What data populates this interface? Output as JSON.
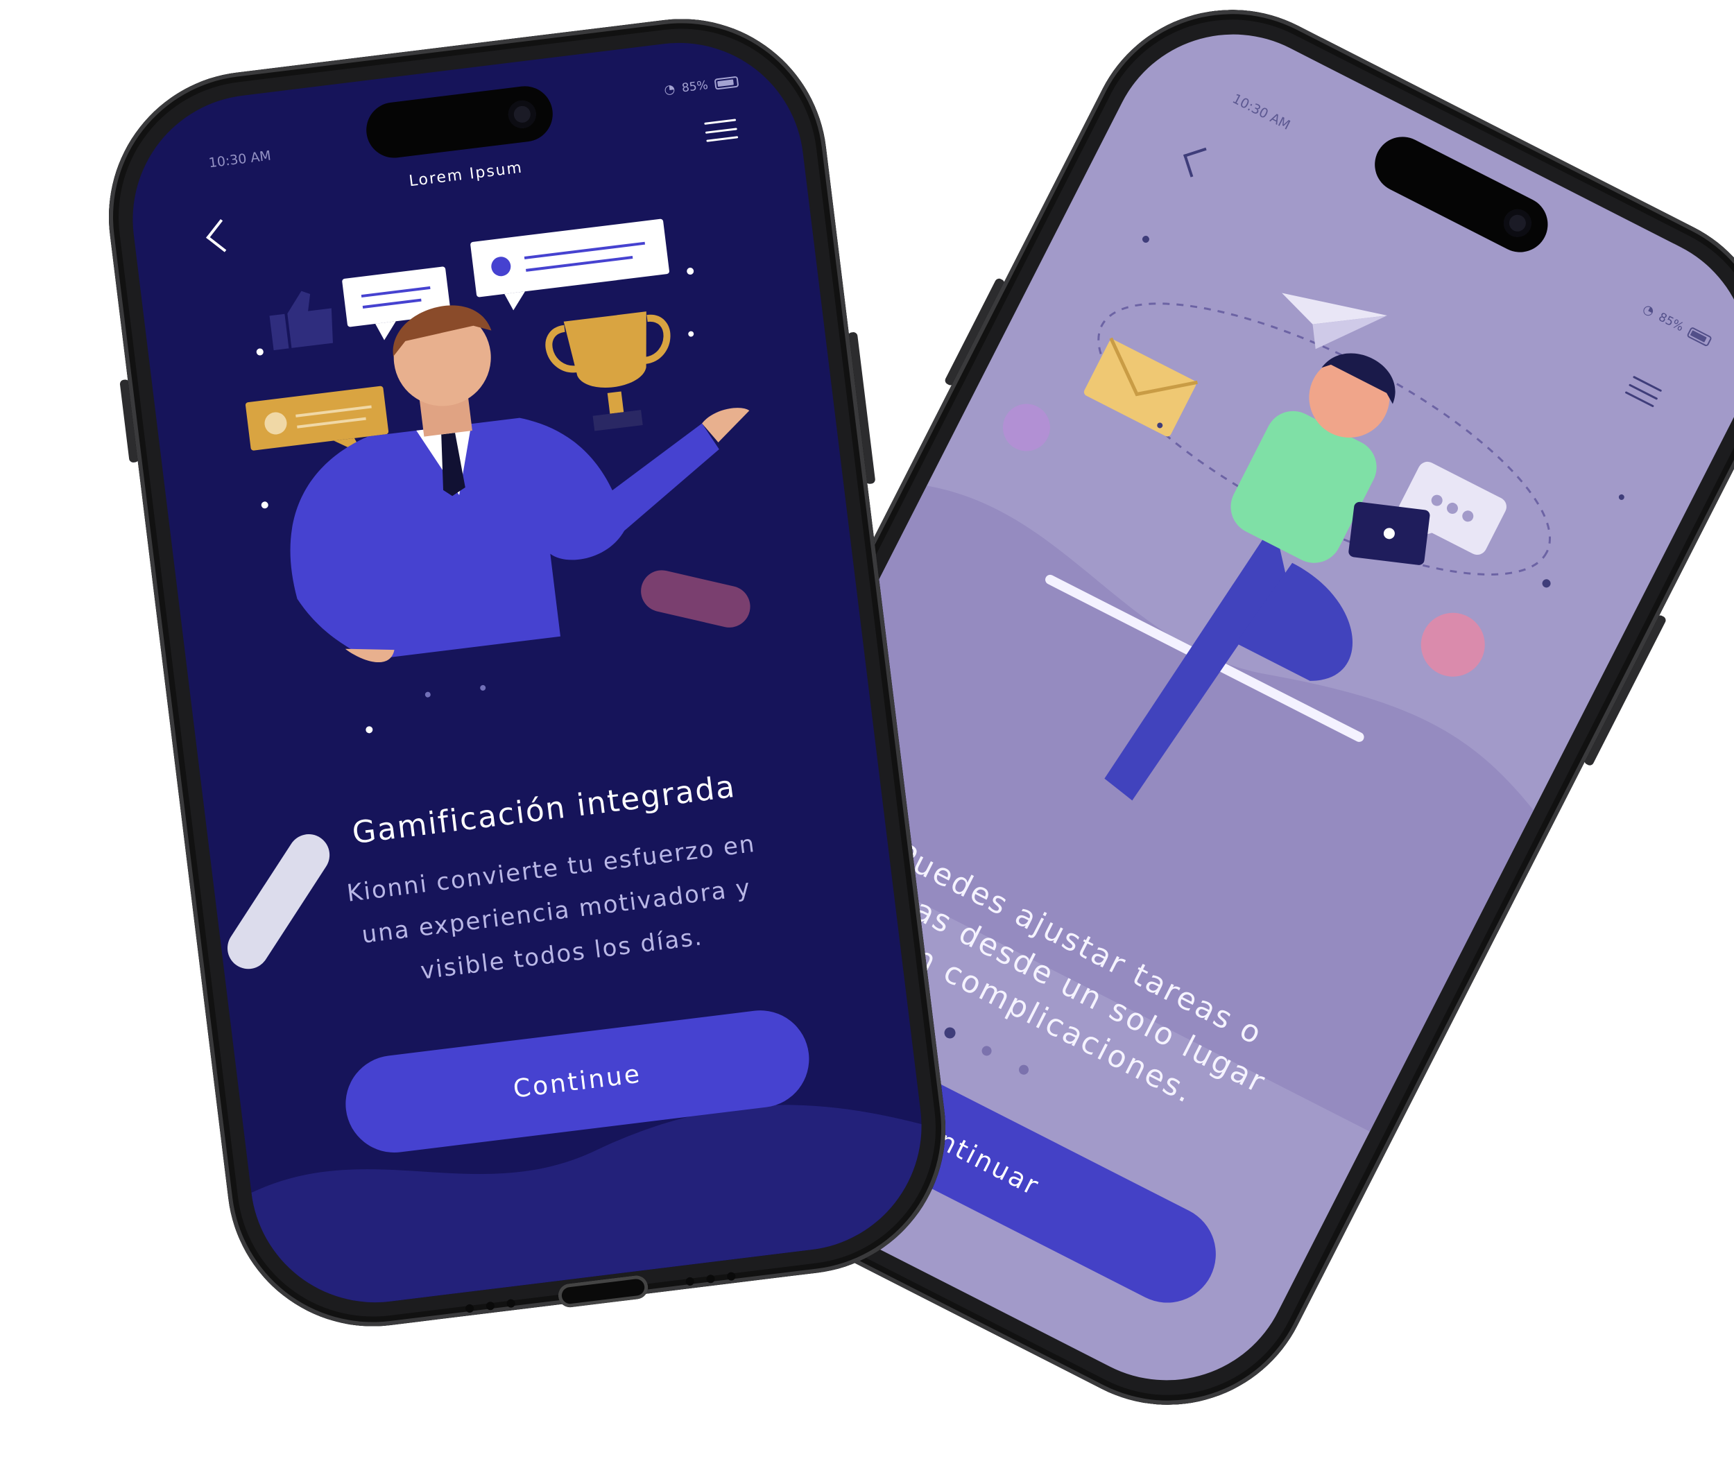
{
  "phone_left": {
    "status_time": "10:30 AM",
    "status_battery": "85%",
    "header_title": "Lorem Ipsum",
    "heading": "Gamificación integrada",
    "description_lines": [
      "Kionni convierte tu esfuerzo en",
      "una experiencia motivadora y",
      "visible todos los días."
    ],
    "cta_label": "Continue",
    "colors": {
      "background": "#16145a",
      "button": "#4642d0",
      "accent": "#d9a441"
    }
  },
  "phone_right": {
    "status_time": "10:30 AM",
    "status_battery": "85%",
    "description_lines": [
      "Puedes ajustar tareas o",
      "metas desde un solo lugar",
      "sin complicaciones."
    ],
    "cta_label": "Continuar",
    "colors": {
      "background": "#a29ac9",
      "button": "#4441c6",
      "accent": "#efc873"
    }
  },
  "icons": [
    "back-arrow-icon",
    "hamburger-menu-icon",
    "wifi-icon",
    "battery-icon",
    "trophy-icon",
    "thumbs-up-icon",
    "chat-bubble-icon",
    "paper-plane-icon",
    "envelope-icon",
    "tablet-icon"
  ]
}
